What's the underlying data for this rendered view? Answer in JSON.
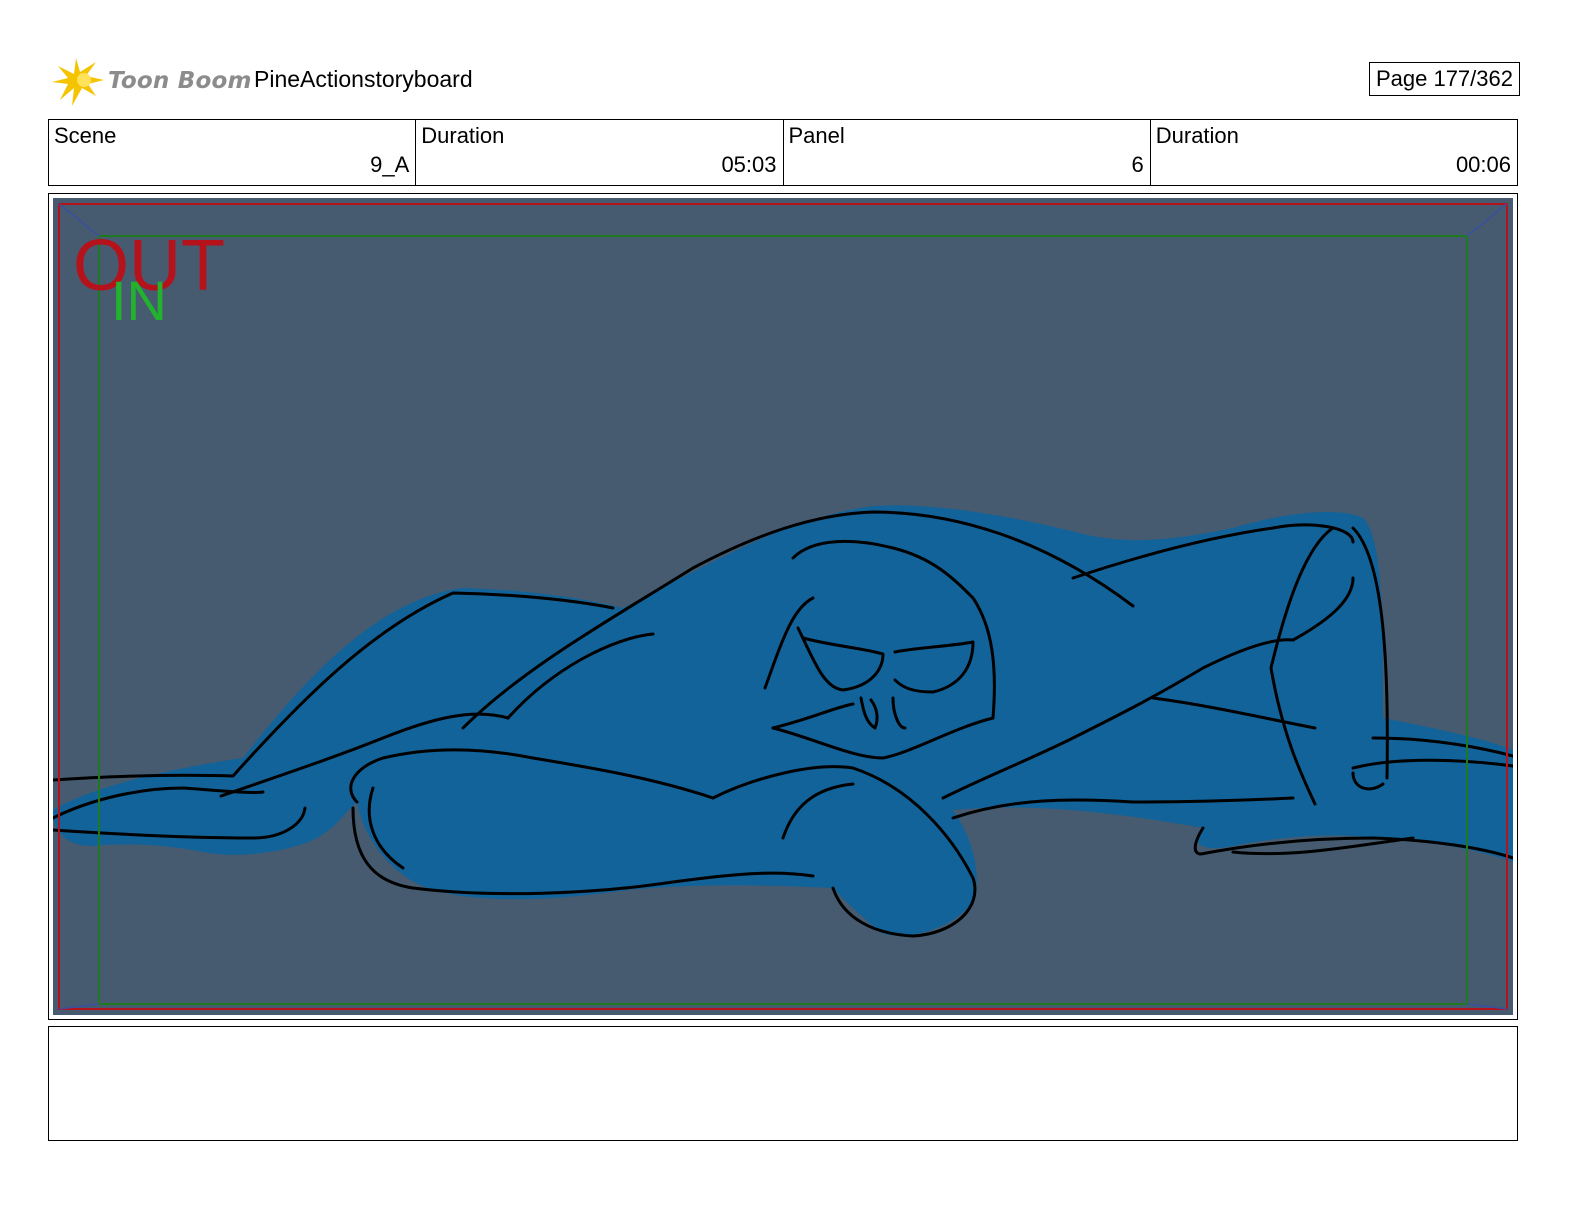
{
  "header": {
    "logo_text": "Toon Boom",
    "project_title": "PineActionstoryboard",
    "page_indicator": "Page 177/362"
  },
  "info_table": {
    "scene": {
      "label": "Scene",
      "value": "9_A"
    },
    "scene_duration": {
      "label": "Duration",
      "value": "05:03"
    },
    "panel": {
      "label": "Panel",
      "value": "6"
    },
    "panel_duration": {
      "label": "Duration",
      "value": "00:06"
    }
  },
  "panel_overlay": {
    "out_label": "OUT",
    "in_label": "IN"
  },
  "colors": {
    "background": "#465b70",
    "figure_fill": "#12639a",
    "out_frame": "#b5121b",
    "in_frame": "#1f7a1f",
    "in_text": "#22b22e",
    "logo_star": "#f5c400",
    "logo_text": "#8c8c8c"
  },
  "notes": ""
}
